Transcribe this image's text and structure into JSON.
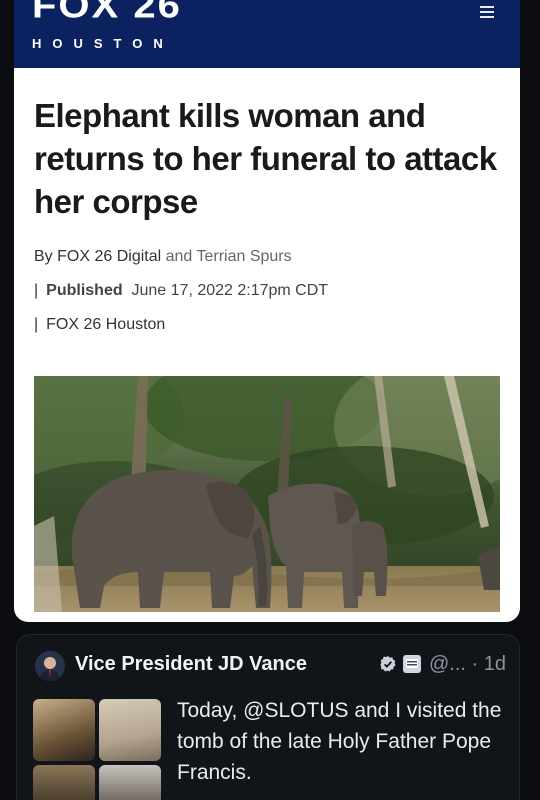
{
  "news": {
    "brand_name": "FOX 26",
    "brand_city": "HOUSTON",
    "headline": "Elephant kills woman and returns to her funeral to attack her corpse",
    "byline_prefix": "By",
    "author_1": "FOX 26 Digital",
    "byline_and": "and",
    "author_2": "Terrian Spurs",
    "separator": "|",
    "published_label": "Published",
    "published_date": "June 17, 2022 2:17pm CDT",
    "source": "FOX 26 Houston",
    "photo_icon": "elephants-photo"
  },
  "post": {
    "author_name": "Vice President JD Vance",
    "handle": "@...",
    "time": "· 1d",
    "text": "Today, @SLOTUS and I visited the tomb of the late Holy Father Pope Francis.",
    "verified_icon": "verified-badge-icon",
    "gov_icon": "government-badge-icon"
  },
  "colors": {
    "header_navy": "#0c2260",
    "page_background": "#0b0d10",
    "verified_blue": "#1d9bf0"
  }
}
